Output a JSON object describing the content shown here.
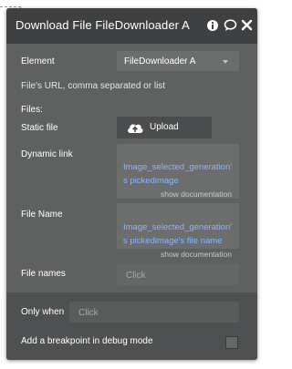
{
  "panel": {
    "title": "Download File FileDownloader A",
    "icons": [
      "info-icon",
      "comment-icon",
      "close-icon"
    ]
  },
  "element": {
    "label": "Element",
    "value": "FileDownloader A"
  },
  "hint": "File's URL, comma separated or list",
  "files_heading": "Files:",
  "static_file": {
    "label": "Static file",
    "button_label": "Upload"
  },
  "dynamic_link": {
    "label": "Dynamic link",
    "expression_line1": "Image_selected_generation'",
    "expression_line2": "s pickedimage",
    "doc_link": "show documentation"
  },
  "file_name": {
    "label": "File Name",
    "expression_line1": "Image_selected_generation'",
    "expression_line2": "s pickedimage's file name",
    "doc_link": "show documentation"
  },
  "file_names": {
    "label": "File names",
    "placeholder": "Click"
  },
  "only_when": {
    "label": "Only when",
    "placeholder": "Click"
  },
  "breakpoint": {
    "label": "Add a breakpoint in debug mode"
  },
  "colors": {
    "panel_bg": "#5f6161",
    "header_bg": "#3f4042",
    "field_bg": "#6c6e6e",
    "expression_text": "#8ab4ff"
  }
}
